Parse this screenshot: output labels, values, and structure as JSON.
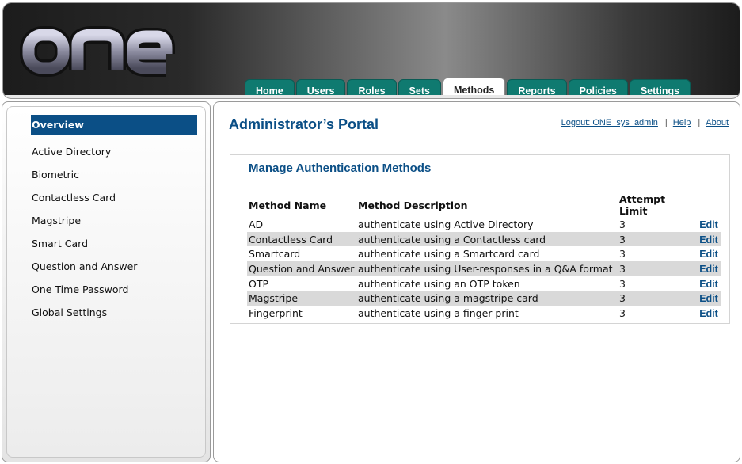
{
  "header": {
    "logo_text": "one",
    "tabs": [
      "Home",
      "Users",
      "Roles",
      "Sets",
      "Methods",
      "Reports",
      "Policies",
      "Settings"
    ],
    "active_tab": "Methods"
  },
  "sidebar": {
    "items": [
      {
        "label": "Overview",
        "active": true
      },
      {
        "label": "Active Directory"
      },
      {
        "label": "Biometric"
      },
      {
        "label": "Contactless Card"
      },
      {
        "label": "Magstripe"
      },
      {
        "label": "Smart Card"
      },
      {
        "label": "Question and Answer"
      },
      {
        "label": "One Time Password"
      },
      {
        "label": "Global Settings"
      }
    ]
  },
  "main": {
    "title": "Administrator’s Portal",
    "links": {
      "logout": "Logout: ONE_sys_admin",
      "help": "Help",
      "about": "About",
      "separator": "|"
    },
    "panel_title": "Manage Authentication Methods",
    "columns": [
      "Method Name",
      "Method Description",
      "Attempt Limit",
      ""
    ],
    "edit_label": "Edit",
    "rows": [
      {
        "name": "AD",
        "description": "authenticate using Active Directory",
        "limit": "3"
      },
      {
        "name": "Contactless Card",
        "description": "authenticate using a Contactless card",
        "limit": "3"
      },
      {
        "name": "Smartcard",
        "description": "authenticate using a Smartcard card",
        "limit": "3"
      },
      {
        "name": "Question and Answer",
        "description": "authenticate using User-responses in a Q&A format",
        "limit": "3"
      },
      {
        "name": "OTP",
        "description": "authenticate using an OTP token",
        "limit": "3"
      },
      {
        "name": "Magstripe",
        "description": "authenticate using a magstripe card",
        "limit": "3"
      },
      {
        "name": "Fingerprint",
        "description": "authenticate using a finger print",
        "limit": "3"
      }
    ]
  },
  "colors": {
    "accent": "#0b4f86",
    "tab": "#0f7a70",
    "row_shade": "#d9d9d9"
  }
}
